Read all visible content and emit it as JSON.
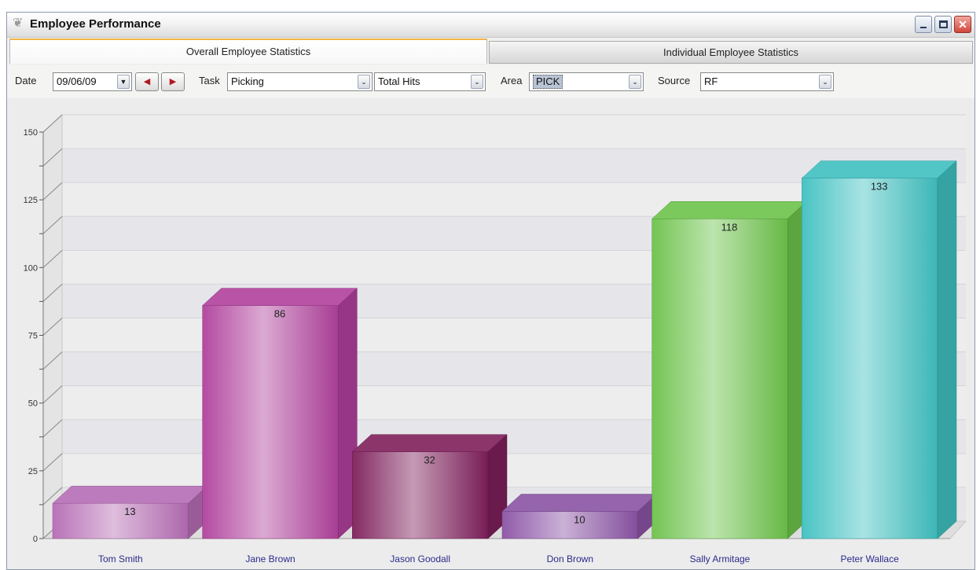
{
  "window": {
    "title": "Employee Performance",
    "app_icon": "app-logo-icon",
    "controls": [
      "minimize-icon",
      "maximize-icon",
      "close-icon"
    ]
  },
  "tabs": [
    {
      "label": "Overall Employee Statistics",
      "active": true
    },
    {
      "label": "Individual Employee Statistics",
      "active": false
    }
  ],
  "filters": {
    "date_label": "Date",
    "date_value": "09/06/09",
    "prev_icon": "arrow-left-icon",
    "next_icon": "arrow-right-icon",
    "task_label": "Task",
    "task_value": "Picking",
    "metric_value": "Total Hits",
    "area_label": "Area",
    "area_value": "PICK",
    "source_label": "Source",
    "source_value": "RF"
  },
  "colors": {
    "tab_accent": "#f2b544",
    "nav_arrow": "#b2181f"
  },
  "chart_data": {
    "type": "bar",
    "style": "3d",
    "categories": [
      "Tom Smith",
      "Jane Brown",
      "Jason Goodall",
      "Don Brown",
      "Sally Armitage",
      "Peter Wallace"
    ],
    "values": [
      13,
      86,
      32,
      10,
      118,
      133
    ],
    "bar_colors": [
      "#b56cb4",
      "#b0409c",
      "#7e1f5a",
      "#8a52a4",
      "#6cc24a",
      "#3fc0c0"
    ],
    "y_ticks": [
      0,
      25,
      50,
      75,
      100,
      125,
      150
    ],
    "ylim": [
      0,
      150
    ],
    "grid": true,
    "data_labels": true
  }
}
